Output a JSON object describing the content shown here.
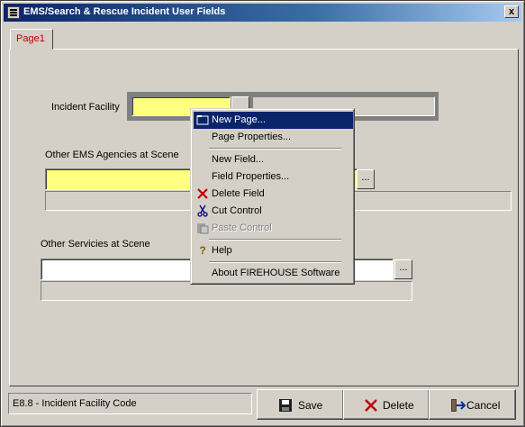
{
  "window": {
    "title": "EMS/Search & Rescue Incident User Fields",
    "close": "x"
  },
  "tabs": [
    {
      "label": "Page1"
    }
  ],
  "fields": {
    "incident_facility": {
      "label": "Incident Facility",
      "value": "",
      "description": ""
    },
    "other_ems": {
      "label": "Other EMS Agencies at Scene",
      "value": "",
      "description": "",
      "button": "..."
    },
    "other_services": {
      "label": "Other Servicies at Scene",
      "value": "",
      "description": "",
      "button": "..."
    }
  },
  "status": {
    "text": "E8.8 - Incident Facility Code"
  },
  "buttons": {
    "save": "Save",
    "delete": "Delete",
    "cancel": "Cancel"
  },
  "context_menu": {
    "items": [
      {
        "label": "New Page...",
        "icon": "folder-icon"
      },
      {
        "label": "Page Properties...",
        "icon": ""
      },
      {
        "label": "New Field...",
        "icon": ""
      },
      {
        "label": "Field Properties...",
        "icon": ""
      },
      {
        "label": "Delete Field",
        "icon": "delete-x-icon"
      },
      {
        "label": "Cut Control",
        "icon": "scissors-icon"
      },
      {
        "label": "Paste Control",
        "icon": "paste-icon"
      },
      {
        "label": "Help",
        "icon": "help-icon"
      },
      {
        "label": "About FIREHOUSE Software",
        "icon": ""
      }
    ]
  },
  "colors": {
    "selection": "#0a246a",
    "required_field": "#ffff80",
    "tab_text": "#c00000",
    "delete_red": "#c00000"
  }
}
